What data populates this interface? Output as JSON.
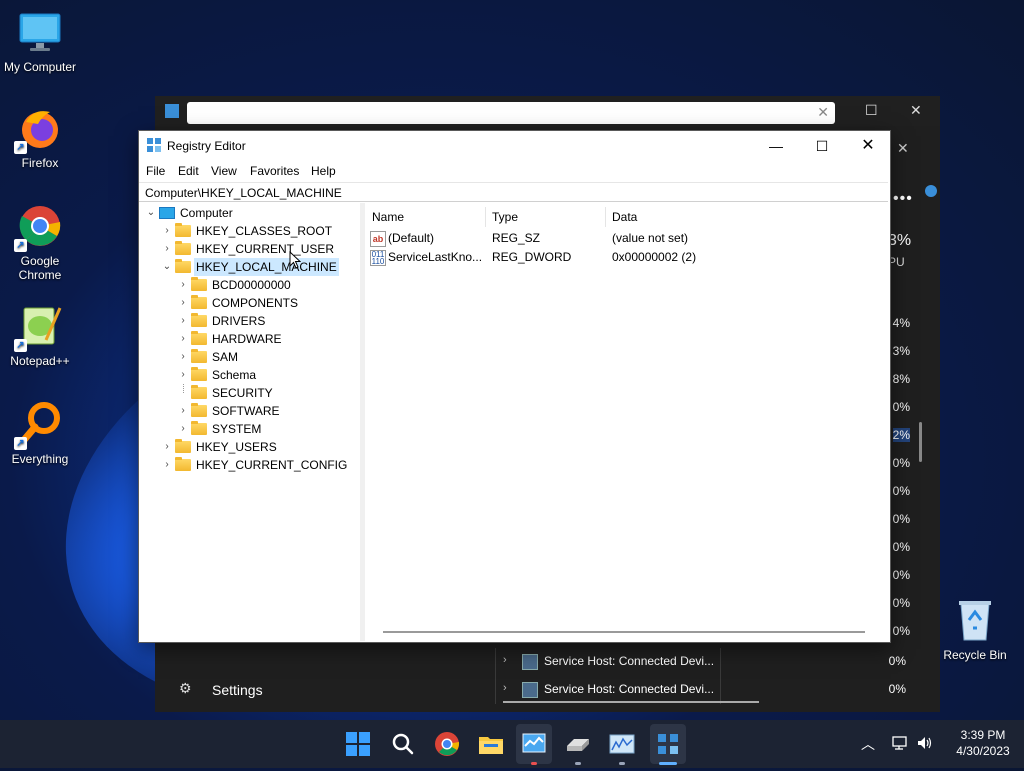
{
  "desktop": {
    "icons": [
      {
        "name": "my-computer",
        "label": "My Computer"
      },
      {
        "name": "firefox",
        "label": "Firefox"
      },
      {
        "name": "google-chrome",
        "label": "Google Chrome"
      },
      {
        "name": "notepad-plus-plus",
        "label": "Notepad++"
      },
      {
        "name": "everything",
        "label": "Everything"
      },
      {
        "name": "recycle-bin",
        "label": "Recycle Bin"
      }
    ]
  },
  "taskmanager": {
    "settings_label": "Settings",
    "cpu_header_pct": "3%",
    "cpu_header_label": "PU",
    "cpu_values": [
      "4%",
      "3%",
      "8%",
      "0%",
      "2%",
      "0%",
      "0%",
      "0%",
      "0%",
      "0%",
      "0%",
      "0%"
    ],
    "rows": [
      {
        "name": "Service Host: Connected Devi...",
        "cpu": "0%"
      },
      {
        "name": "Service Host: Connected Devi...",
        "cpu": "0%"
      }
    ]
  },
  "regedit": {
    "title": "Registry Editor",
    "menu": [
      "File",
      "Edit",
      "View",
      "Favorites",
      "Help"
    ],
    "address": "Computer\\HKEY_LOCAL_MACHINE",
    "tree": {
      "root": "Computer",
      "hives": [
        "HKEY_CLASSES_ROOT",
        "HKEY_CURRENT_USER",
        "HKEY_LOCAL_MACHINE",
        "HKEY_USERS",
        "HKEY_CURRENT_CONFIG"
      ],
      "hklm_children": [
        "BCD00000000",
        "COMPONENTS",
        "DRIVERS",
        "HARDWARE",
        "SAM",
        "Schema",
        "SECURITY",
        "SOFTWARE",
        "SYSTEM"
      ]
    },
    "columns": {
      "name": "Name",
      "type": "Type",
      "data": "Data"
    },
    "values": [
      {
        "name": "(Default)",
        "type": "REG_SZ",
        "data": "(value not set)",
        "icon": "string-value-icon"
      },
      {
        "name": "ServiceLastKno...",
        "type": "REG_DWORD",
        "data": "0x00000002 (2)",
        "icon": "binary-value-icon"
      }
    ]
  },
  "taskbar": {
    "time": "3:39 PM",
    "date": "4/30/2023"
  },
  "colors": {
    "accent": "#0067c0",
    "selection": "#cce8ff",
    "taskbar": "#1c2333"
  }
}
